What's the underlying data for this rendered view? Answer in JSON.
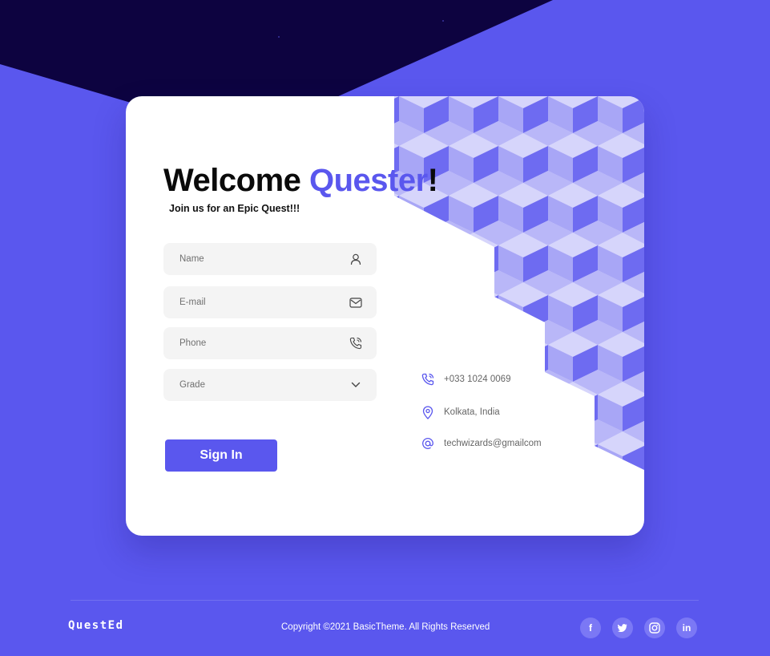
{
  "welcome": {
    "prefix": "Welcome ",
    "name": "Quester",
    "suffix": "!"
  },
  "subtitle": "Join us for an Epic Quest!!!",
  "form": {
    "name_placeholder": "Name",
    "email_placeholder": "E-mail",
    "phone_placeholder": "Phone",
    "grade_placeholder": "Grade",
    "submit_label": "Sign In"
  },
  "contact": {
    "phone": "+033 1024 0069",
    "location": "Kolkata, India",
    "email": "techwizards@gmailcom"
  },
  "footer": {
    "logo": "QuestEd",
    "copyright": "Copyright ©2021 BasicTheme. All Rights Reserved",
    "social": [
      {
        "icon": "facebook-icon",
        "label": "f"
      },
      {
        "icon": "twitter-icon",
        "label": ""
      },
      {
        "icon": "instagram-icon",
        "label": ""
      },
      {
        "icon": "linkedin-icon",
        "label": "in"
      }
    ]
  },
  "colors": {
    "accent": "#5A57EE",
    "dark": "#0D0340",
    "field_bg": "#F4F4F4",
    "cube_light": "#D6D5FB",
    "cube_mid": "#A8A6F6",
    "cube_dark": "#6E6BF1"
  }
}
